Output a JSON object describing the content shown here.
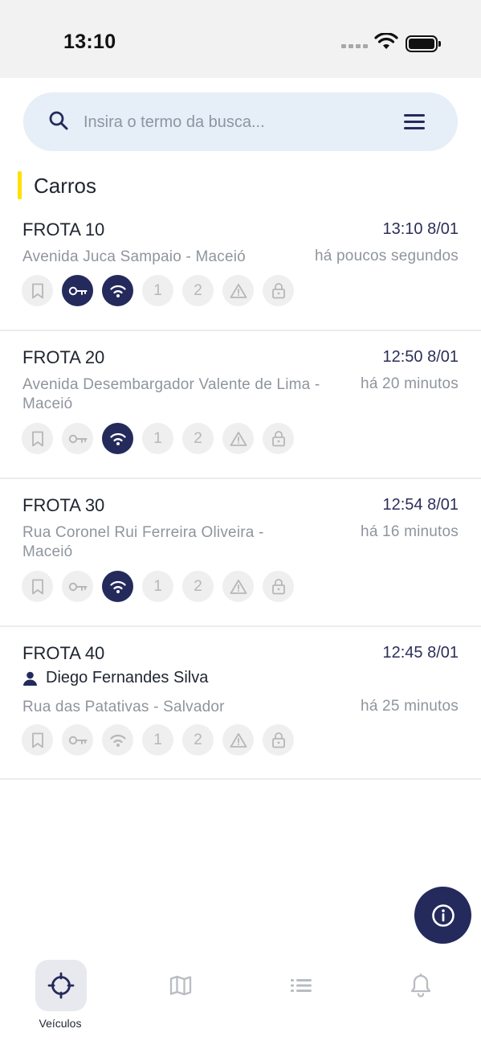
{
  "status_bar": {
    "time": "13:10"
  },
  "search": {
    "placeholder": "Insira o termo da busca..."
  },
  "section": {
    "title": "Carros"
  },
  "colors": {
    "accent": "#ffe100",
    "primary": "#242a5b",
    "inactive_icon": "#b7b7b7",
    "secondary_text": "#8f959d"
  },
  "vehicles": [
    {
      "name": "FROTA 10",
      "time": "13:10 8/01",
      "address": "Avenida Juca Sampaio - Maceió",
      "ago": "há poucos segundos",
      "driver": "",
      "status": {
        "bookmark": false,
        "ignition": true,
        "signal": true,
        "input1": false,
        "input2": false,
        "alert": false,
        "lock": false
      }
    },
    {
      "name": "FROTA 20",
      "time": "12:50 8/01",
      "address": "Avenida Desembargador Valente de Lima - Maceió",
      "ago": "há 20 minutos",
      "driver": "",
      "status": {
        "bookmark": false,
        "ignition": false,
        "signal": true,
        "input1": false,
        "input2": false,
        "alert": false,
        "lock": false
      }
    },
    {
      "name": "FROTA 30",
      "time": "12:54 8/01",
      "address": "Rua Coronel Rui Ferreira Oliveira - Maceió",
      "ago": "há 16 minutos",
      "driver": "",
      "status": {
        "bookmark": false,
        "ignition": false,
        "signal": true,
        "input1": false,
        "input2": false,
        "alert": false,
        "lock": false
      }
    },
    {
      "name": "FROTA 40",
      "time": "12:45 8/01",
      "address": "Rua das Patativas - Salvador",
      "ago": "há 25 minutos",
      "driver": "Diego Fernandes Silva",
      "status": {
        "bookmark": false,
        "ignition": false,
        "signal": false,
        "input1": false,
        "input2": false,
        "alert": false,
        "lock": false
      }
    }
  ],
  "status_labels": {
    "input1": "1",
    "input2": "2"
  },
  "icons": [
    "search-icon",
    "menu-icon",
    "bookmark-icon",
    "key-icon",
    "wifi-icon",
    "alert-icon",
    "lock-icon",
    "person-icon",
    "info-icon",
    "crosshair-icon",
    "map-icon",
    "list-icon",
    "bell-icon"
  ],
  "tabbar": {
    "tabs": [
      {
        "icon": "crosshair-icon",
        "label": "Veículos",
        "active": true
      },
      {
        "icon": "map-icon",
        "label": "",
        "active": false
      },
      {
        "icon": "list-icon",
        "label": "",
        "active": false
      },
      {
        "icon": "bell-icon",
        "label": "",
        "active": false
      }
    ]
  }
}
